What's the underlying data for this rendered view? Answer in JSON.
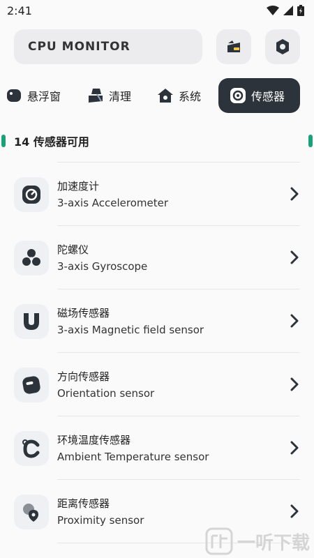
{
  "status_bar": {
    "time": "2:41"
  },
  "header": {
    "app_title": "CPU MONITOR"
  },
  "tabs": [
    {
      "label": "悬浮窗",
      "icon": "floating-window-icon"
    },
    {
      "label": "清理",
      "icon": "broom-icon"
    },
    {
      "label": "系统",
      "icon": "home-icon"
    },
    {
      "label": "传感器",
      "icon": "sensor-icon",
      "active": true
    }
  ],
  "section": {
    "title": "14 传感器可用"
  },
  "sensors": [
    {
      "name": "加速度计",
      "desc": "3-axis Accelerometer",
      "icon": "speedometer-icon"
    },
    {
      "name": "陀螺仪",
      "desc": "3-axis Gyroscope",
      "icon": "fan-icon"
    },
    {
      "name": "磁场传感器",
      "desc": "3-axis Magnetic field sensor",
      "icon": "magnet-icon"
    },
    {
      "name": "方向传感器",
      "desc": "Orientation sensor",
      "icon": "orientation-icon"
    },
    {
      "name": "环境温度传感器",
      "desc": "Ambient Temperature sensor",
      "icon": "temperature-icon"
    },
    {
      "name": "距离传感器",
      "desc": "Proximity sensor",
      "icon": "proximity-icon"
    }
  ],
  "watermark": {
    "text": "一听下载"
  },
  "colors": {
    "accent": "#1aa17a",
    "active_tab_bg": "#2d333a",
    "card_bg": "#ececef"
  }
}
